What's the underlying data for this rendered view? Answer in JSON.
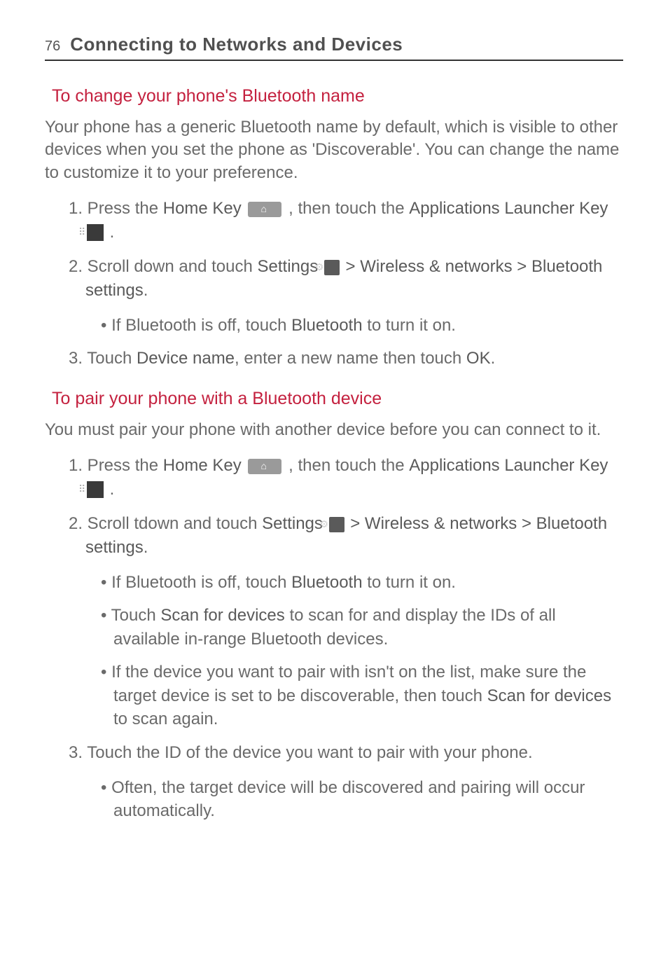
{
  "header": {
    "page_number": "76",
    "title": "Connecting to Networks and Devices"
  },
  "section1": {
    "heading": "To change your phone's Bluetooth name",
    "intro": "Your phone has a generic Bluetooth name by default, which is visible to other devices when you set the phone as 'Discoverable'. You can change the name to customize it to your preference.",
    "step1_a": "1. Press the ",
    "step1_b": "Home Key",
    "step1_c": " , then touch the ",
    "step1_d": "Applications Launcher Key",
    "step1_e": " .",
    "step2_a": "2. Scroll down and touch ",
    "step2_b": "Settings",
    "step2_c": " > ",
    "step2_d": "Wireless & networks > Bluetooth settings",
    "step2_e": ".",
    "bullet1_a": "If Bluetooth is off, touch ",
    "bullet1_b": "Bluetooth",
    "bullet1_c": " to turn it on.",
    "step3_a": "3. Touch ",
    "step3_b": "Device name",
    "step3_c": ", enter a new name then touch ",
    "step3_d": "OK",
    "step3_e": "."
  },
  "section2": {
    "heading": "To pair your phone with a Bluetooth device",
    "intro": "You must pair your phone with another device before you can connect to it.",
    "step1_a": "1. Press the ",
    "step1_b": "Home Key",
    "step1_c": " , then touch the ",
    "step1_d": "Applications Launcher Key",
    "step1_e": " .",
    "step2_a": "2. Scroll tdown and touch ",
    "step2_b": "Settings",
    "step2_c": " > ",
    "step2_d": "Wireless & networks > Bluetooth settings",
    "step2_e": ".",
    "bullet1_a": "If Bluetooth is off, touch ",
    "bullet1_b": "Bluetooth",
    "bullet1_c": " to turn it on.",
    "bullet2_a": "Touch ",
    "bullet2_b": "Scan for devices",
    "bullet2_c": " to scan for and display the IDs of all available in-range Bluetooth devices.",
    "bullet3_a": "If the device you want to pair with isn't on the list, make sure the target device is set to be discoverable, then touch ",
    "bullet3_b": "Scan for devices",
    "bullet3_c": " to scan again.",
    "step3": "3. Touch the ID of the device you want to pair with your phone.",
    "bullet4": "Often, the target device will be discovered and pairing will occur automatically."
  }
}
